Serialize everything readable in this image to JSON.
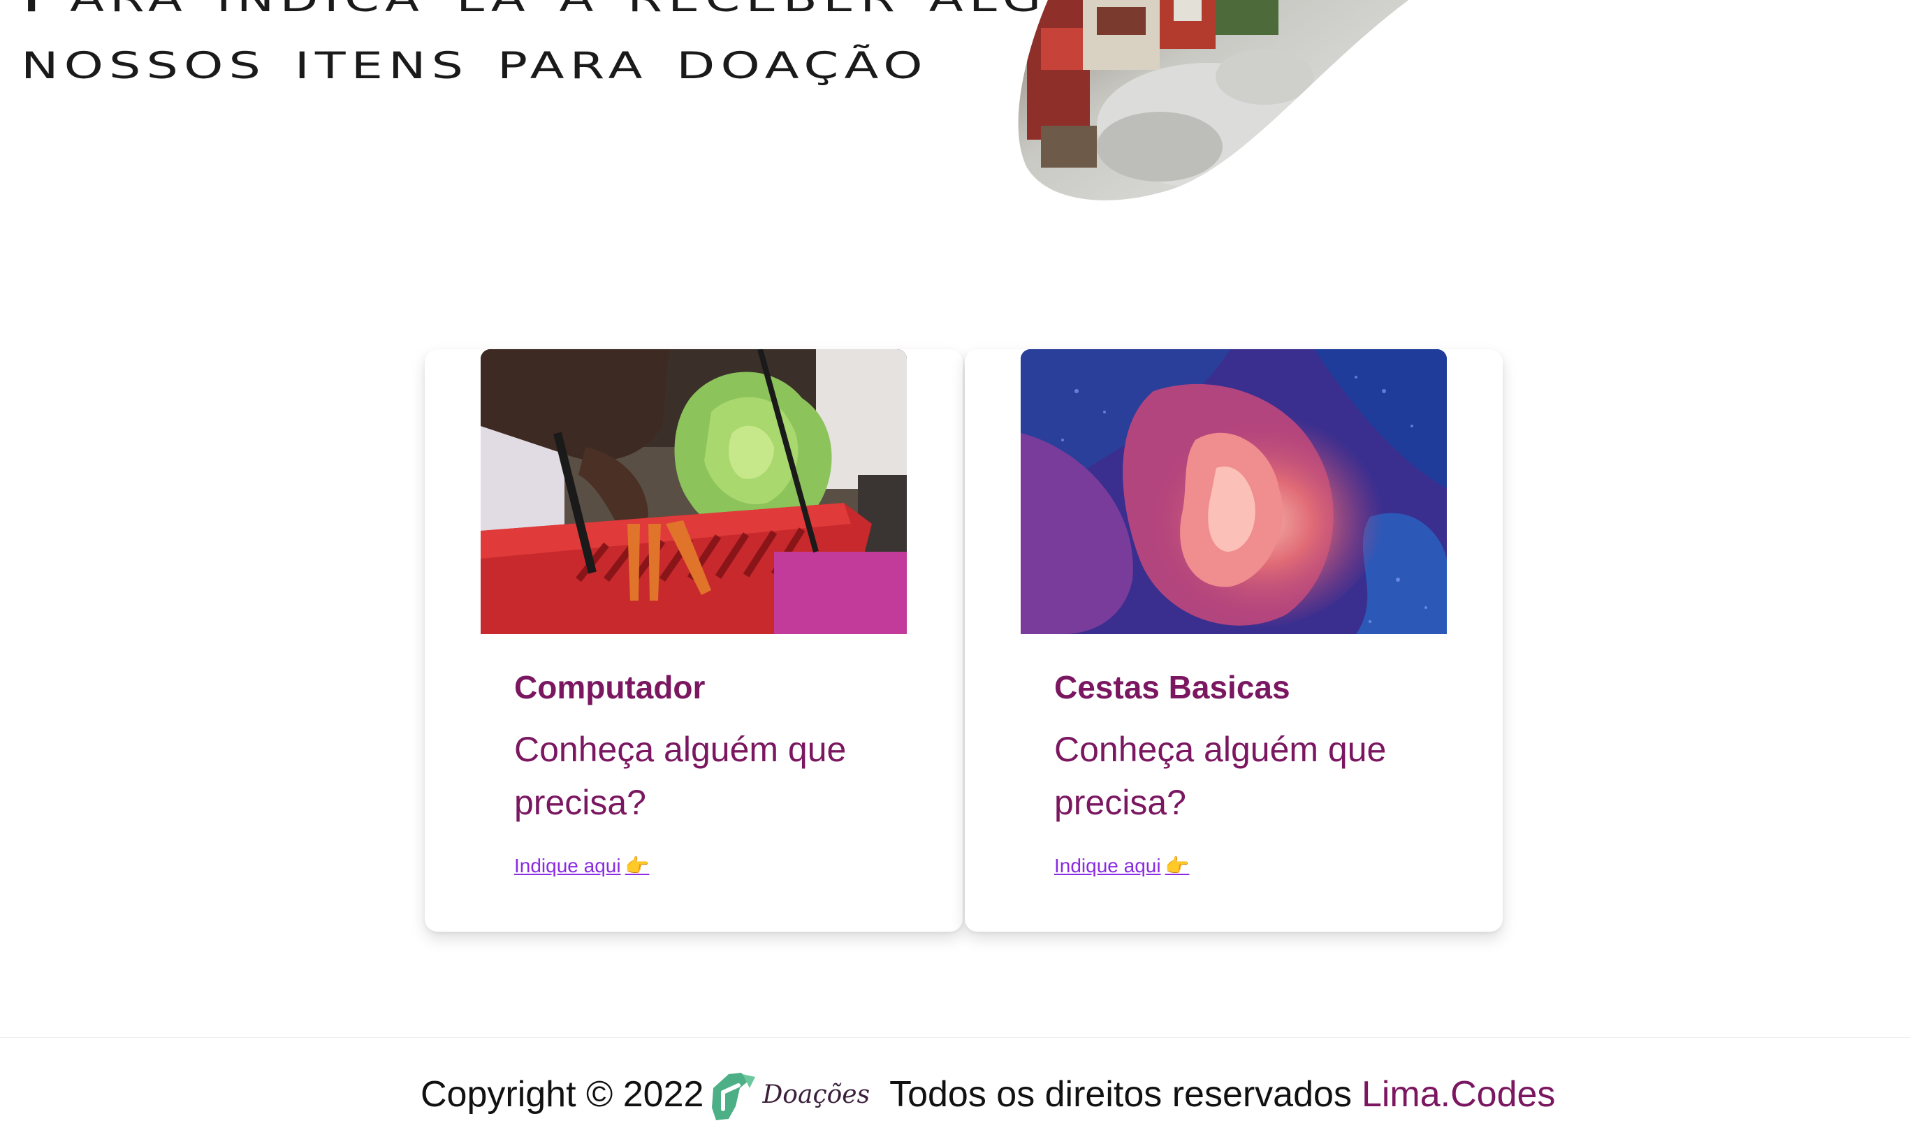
{
  "hero": {
    "title_line1": "Para indicá-la a receber algum de",
    "title_line2": "nossos itens para doação"
  },
  "cards": [
    {
      "title": "Computador",
      "text": "Conheça alguém que precisa?",
      "link_label": "Indique aqui",
      "link_emoji": "👉"
    },
    {
      "title": "Cestas Basicas",
      "text": "Conheça alguém que precisa?",
      "link_label": "Indique aqui",
      "link_emoji": "👉"
    }
  ],
  "footer": {
    "copyright": "Copyright © 2022",
    "logo_text": "Doações",
    "rights": "Todos os direitos reservados",
    "brand": "Lima.Codes"
  },
  "colors": {
    "accent": "#7a1760",
    "link": "#8a2be2",
    "logo_green": "#4caf86"
  }
}
